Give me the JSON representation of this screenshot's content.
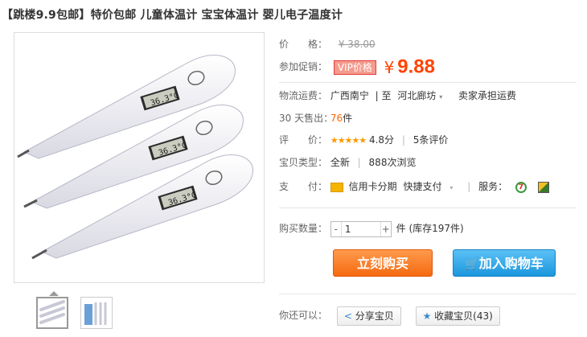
{
  "title": "【跳楼9.9包邮】特价包邮 儿童体温计 宝宝体温计 婴儿电子温度计",
  "thermometer_display": "36.3°C",
  "price": {
    "label": "价　　格：",
    "original": "¥ 38.00"
  },
  "promo": {
    "label": "参加促销：",
    "tag": "VIP价格",
    "currency": "¥",
    "value": "9.88"
  },
  "shipping": {
    "label": "物流运费：",
    "from": "广西南宁",
    "sep": "| 至",
    "to": "河北廊坊",
    "note": "卖家承担运费"
  },
  "sales": {
    "label": "30 天售出：",
    "count": "76",
    "unit": "件"
  },
  "rating": {
    "label": "评　　价：",
    "stars": "★★★★★",
    "score": "4.8分",
    "reviews": "5条评价"
  },
  "item_type": {
    "label": "宝贝类型：",
    "condition": "全新",
    "views": "888次浏览"
  },
  "payment": {
    "label": "支　　付：",
    "credit": "信用卡分期",
    "fast": "快捷支付",
    "service_label": "服务："
  },
  "quantity": {
    "label": "购买数量：",
    "minus": "-",
    "value": "1",
    "plus": "+",
    "stock": "件 (库存197件)"
  },
  "buttons": {
    "buy_now": "立刻购买",
    "add_cart": "加入购物车"
  },
  "share": {
    "label": "你还可以：",
    "share_btn": "分享宝贝",
    "fav_btn": "收藏宝贝(43)"
  },
  "colors": {
    "price": "#ff4400",
    "buy": "#f56a10",
    "cart": "#1c97dd"
  }
}
